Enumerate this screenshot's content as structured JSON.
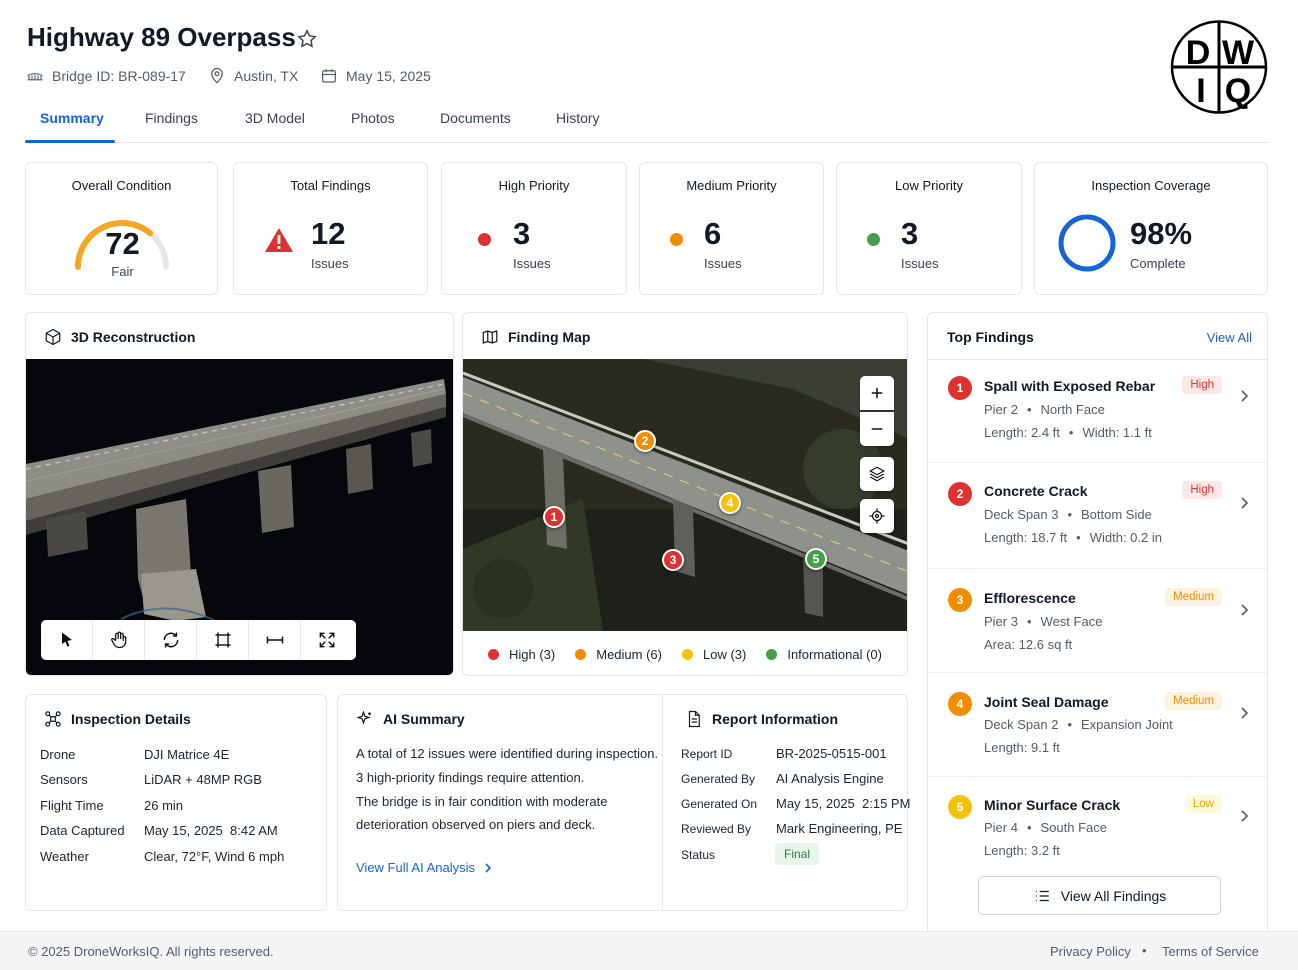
{
  "header": {
    "title": "Highway 89 Overpass",
    "bridge_id": "Bridge ID: BR-089-17",
    "location": "Austin, TX",
    "date": "May 15, 2025",
    "logo_text": "DWIQ"
  },
  "tabs": [
    "Summary",
    "Findings",
    "3D Model",
    "Photos",
    "Documents",
    "History"
  ],
  "kpis": {
    "overall": {
      "title": "Overall Condition",
      "value": "72",
      "label": "Fair",
      "score_fraction": 0.72
    },
    "total": {
      "title": "Total Findings",
      "value": "12",
      "label": "Issues"
    },
    "high": {
      "title": "High Priority",
      "value": "3",
      "label": "Issues"
    },
    "medium": {
      "title": "Medium Priority",
      "value": "6",
      "label": "Issues"
    },
    "low": {
      "title": "Low Priority",
      "value": "3",
      "label": "Issues"
    },
    "coverage": {
      "title": "Inspection Coverage",
      "value": "98%",
      "label": "Complete",
      "fraction": 0.98
    }
  },
  "recon": {
    "title": "3D Reconstruction"
  },
  "map": {
    "title": "Finding Map",
    "pins": [
      "1",
      "2",
      "3",
      "4",
      "5"
    ],
    "legend": [
      "High (3)",
      "Medium (6)",
      "Low (3)",
      "Informational (0)"
    ]
  },
  "colors": {
    "accent": "#1565d8",
    "high": "#e03131",
    "medium": "#f08c00",
    "low": "#f4c20d",
    "info": "#43a047"
  },
  "inspection": {
    "title": "Inspection Details",
    "rows": [
      {
        "k": "Drone",
        "v": "DJI Matrice 4E"
      },
      {
        "k": "Sensors",
        "v": "LiDAR + 48MP RGB"
      },
      {
        "k": "Flight Time",
        "v": "26 min"
      },
      {
        "k": "Data Captured",
        "v": "May 15, 2025  8:42 AM"
      },
      {
        "k": "Weather",
        "v": "Clear, 72°F, Wind 6 mph"
      }
    ]
  },
  "ai": {
    "title": "AI Summary",
    "lines": [
      "A total of 12 issues were identified during inspection.",
      "3 high-priority findings require attention.",
      "The bridge is in fair condition with moderate",
      "deterioration observed on piers and deck."
    ],
    "link": "View Full AI Analysis"
  },
  "report": {
    "title": "Report Information",
    "rows": [
      {
        "k": "Report ID",
        "v": "BR-2025-0515-001"
      },
      {
        "k": "Generated By",
        "v": "AI Analysis Engine"
      },
      {
        "k": "Generated On",
        "v": "May 15, 2025  2:15 PM"
      },
      {
        "k": "Reviewed By",
        "v": "Mark Engineering, PE"
      },
      {
        "k": "Status",
        "v": "Final"
      }
    ]
  },
  "top_findings": {
    "title": "Top Findings",
    "view_all": "View All",
    "button": "View All Findings",
    "items": [
      {
        "n": "1",
        "title": "Spall with Exposed Rebar",
        "badge": "High",
        "loc1": "Pier 2",
        "loc2": "North Face",
        "m1": "Length: 2.4 ft",
        "m2": "Width: 1.1 ft"
      },
      {
        "n": "2",
        "title": "Concrete Crack",
        "badge": "High",
        "loc1": "Deck Span 3",
        "loc2": "Bottom Side",
        "m1": "Length: 18.7 ft",
        "m2": "Width: 0.2 in"
      },
      {
        "n": "3",
        "title": "Efflorescence",
        "badge": "Medium",
        "loc1": "Pier 3",
        "loc2": "West Face",
        "m1": "Area: 12.6 sq ft",
        "m2": ""
      },
      {
        "n": "4",
        "title": "Joint Seal Damage",
        "badge": "Medium",
        "loc1": "Deck Span 2",
        "loc2": "Expansion Joint",
        "m1": "Length: 9.1 ft",
        "m2": ""
      },
      {
        "n": "5",
        "title": "Minor Surface Crack",
        "badge": "Low",
        "loc1": "Pier 4",
        "loc2": "South Face",
        "m1": "Length: 3.2 ft",
        "m2": ""
      }
    ]
  },
  "footer": {
    "copyright": "© 2025 DroneWorksIQ. All rights reserved.",
    "privacy": "Privacy Policy",
    "terms": "Terms of Service"
  }
}
